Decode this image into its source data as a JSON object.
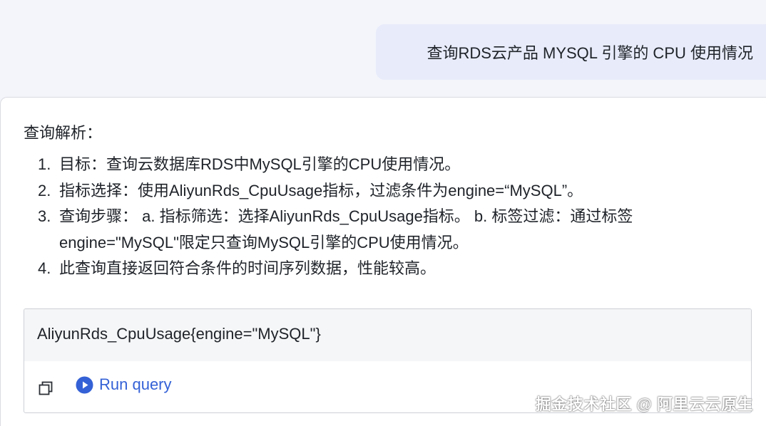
{
  "user_message": {
    "text": "查询RDS云产品 MYSQL 引擎的 CPU 使用情况"
  },
  "answer": {
    "analysis_title": "查询解析：",
    "steps": [
      {
        "number": "1.",
        "text": "目标：查询云数据库RDS中MySQL引擎的CPU使用情况。"
      },
      {
        "number": "2.",
        "text": "指标选择：使用AliyunRds_CpuUsage指标，过滤条件为engine=“MySQL”。"
      },
      {
        "number": "3.",
        "text": "查询步骤： a. 指标筛选：选择AliyunRds_CpuUsage指标。 b. 标签过滤：通过标签engine=\"MySQL\"限定只查询MySQL引擎的CPU使用情况。"
      },
      {
        "number": "4.",
        "text": "此查询直接返回符合条件的时间序列数据，性能较高。"
      }
    ]
  },
  "code_box": {
    "query": "AliyunRds_CpuUsage{engine=\"MySQL\"}",
    "copy_icon": "copy-icon",
    "run_icon": "play-circle-icon",
    "run_label": "Run query"
  },
  "watermark": {
    "text": "掘金技术社区 @ 阿里云云原生"
  },
  "colors": {
    "page_background": "#f4f5fb",
    "user_bubble": "#e8ecfa",
    "card_background": "#ffffff",
    "code_background": "#f5f6f7",
    "accent": "#3461d6",
    "text": "#1f2329"
  }
}
